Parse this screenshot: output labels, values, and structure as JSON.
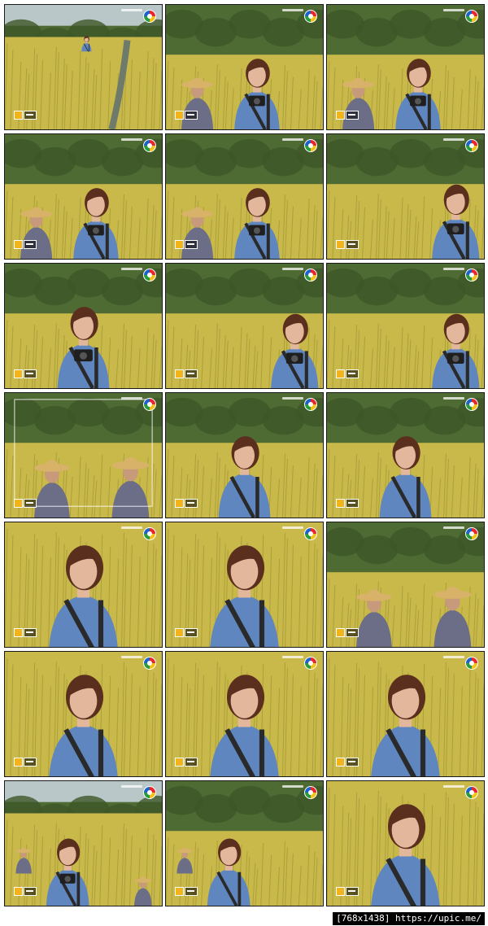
{
  "footer": {
    "label": "[768x1438] https://upic.me/"
  },
  "frames": [
    {
      "id": "r1c1",
      "scene": "wide",
      "sky": true,
      "people": 1,
      "camera": false,
      "hat": false
    },
    {
      "id": "r1c2",
      "scene": "pair",
      "sky": false,
      "people": 2,
      "camera": true,
      "hat": true
    },
    {
      "id": "r1c3",
      "scene": "pair",
      "sky": false,
      "people": 2,
      "camera": true,
      "hat": true
    },
    {
      "id": "r2c1",
      "scene": "pair",
      "sky": false,
      "people": 2,
      "camera": true,
      "hat": true
    },
    {
      "id": "r2c2",
      "scene": "pair",
      "sky": false,
      "people": 2,
      "camera": true,
      "hat": true
    },
    {
      "id": "r2c3",
      "scene": "single-right",
      "sky": false,
      "people": 1,
      "camera": true,
      "hat": false
    },
    {
      "id": "r3c1",
      "scene": "single-center",
      "sky": false,
      "people": 1,
      "camera": true,
      "hat": false
    },
    {
      "id": "r3c2",
      "scene": "single-right",
      "sky": false,
      "people": 1,
      "camera": true,
      "hat": false
    },
    {
      "id": "r3c3",
      "scene": "single-right",
      "sky": false,
      "people": 1,
      "camera": true,
      "hat": false
    },
    {
      "id": "r4c1",
      "scene": "farmers",
      "sky": false,
      "people": 2,
      "camera": false,
      "hat": true,
      "viewfinder": true
    },
    {
      "id": "r4c2",
      "scene": "single-center",
      "sky": false,
      "people": 1,
      "camera": false,
      "hat": false
    },
    {
      "id": "r4c3",
      "scene": "single-center",
      "sky": false,
      "people": 1,
      "camera": false,
      "hat": false
    },
    {
      "id": "r5c1",
      "scene": "closeup",
      "sky": false,
      "people": 1,
      "camera": false,
      "hat": false
    },
    {
      "id": "r5c2",
      "scene": "closeup",
      "sky": false,
      "people": 1,
      "camera": false,
      "hat": false
    },
    {
      "id": "r5c3",
      "scene": "farmers",
      "sky": false,
      "people": 2,
      "camera": false,
      "hat": true
    },
    {
      "id": "r6c1",
      "scene": "closeup",
      "sky": false,
      "people": 1,
      "camera": false,
      "hat": false
    },
    {
      "id": "r6c2",
      "scene": "closeup",
      "sky": false,
      "people": 1,
      "camera": false,
      "hat": false
    },
    {
      "id": "r6c3",
      "scene": "closeup",
      "sky": false,
      "people": 1,
      "camera": false,
      "hat": false
    },
    {
      "id": "r7c1",
      "scene": "walk",
      "sky": true,
      "people": 3,
      "camera": true,
      "hat": true
    },
    {
      "id": "r7c2",
      "scene": "walk",
      "sky": false,
      "people": 2,
      "camera": false,
      "hat": true
    },
    {
      "id": "r7c3",
      "scene": "closeup",
      "sky": false,
      "people": 1,
      "camera": false,
      "hat": false
    }
  ],
  "colors": {
    "field": "#c9b84a",
    "field_dark": "#8e8a2e",
    "trees": "#4f6b34",
    "sky": "#b9c7c9",
    "shirt": "#5f86bf",
    "hair": "#5a2f1d",
    "skin": "#e2b79c",
    "strap": "#2a2a2a",
    "plaid": "#6b6e86",
    "straw": "#d9b26a"
  }
}
